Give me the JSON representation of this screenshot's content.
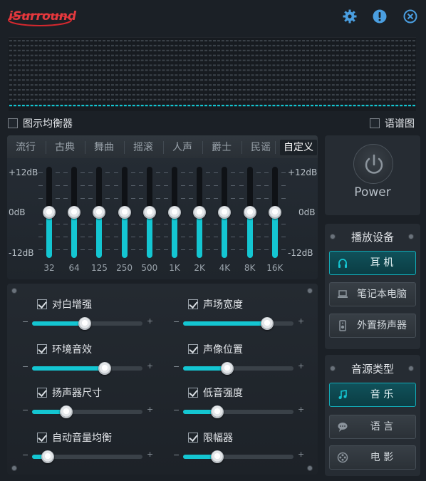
{
  "app": {
    "logo_text": "iSurround"
  },
  "header": {
    "icons": [
      "gear-icon",
      "info-icon",
      "close-icon"
    ]
  },
  "toggles": {
    "graphic_eq": {
      "label": "图示均衡器",
      "checked": false
    },
    "spectrum": {
      "label": "语谱图",
      "checked": false
    }
  },
  "eq": {
    "presets": [
      "流行",
      "古典",
      "舞曲",
      "摇滚",
      "人声",
      "爵士",
      "民谣",
      "自定义"
    ],
    "active_preset": "自定义",
    "db_top": "+12dB",
    "db_mid": "0dB",
    "db_bottom": "-12dB",
    "bands": [
      {
        "freq": "32",
        "gain_db": 0
      },
      {
        "freq": "64",
        "gain_db": 0
      },
      {
        "freq": "125",
        "gain_db": 0
      },
      {
        "freq": "250",
        "gain_db": 0
      },
      {
        "freq": "500",
        "gain_db": 0
      },
      {
        "freq": "1K",
        "gain_db": 0
      },
      {
        "freq": "2K",
        "gain_db": 0
      },
      {
        "freq": "4K",
        "gain_db": 0
      },
      {
        "freq": "8K",
        "gain_db": 0
      },
      {
        "freq": "16K",
        "gain_db": 0
      }
    ]
  },
  "effects": [
    {
      "label": "对白增强",
      "checked": true,
      "level": 0.48
    },
    {
      "label": "声场宽度",
      "checked": true,
      "level": 0.76
    },
    {
      "label": "环境音效",
      "checked": true,
      "level": 0.66
    },
    {
      "label": "声像位置",
      "checked": true,
      "level": 0.4
    },
    {
      "label": "扬声器尺寸",
      "checked": true,
      "level": 0.31
    },
    {
      "label": "低音强度",
      "checked": true,
      "level": 0.31
    },
    {
      "label": "自动音量均衡",
      "checked": true,
      "level": 0.14
    },
    {
      "label": "限幅器",
      "checked": true,
      "level": 0.31
    }
  ],
  "slider_minus": "−",
  "slider_plus": "+",
  "power": {
    "label": "Power"
  },
  "device": {
    "title": "播放设备",
    "options": [
      {
        "label": "耳 机",
        "icon": "headphones-icon",
        "active": true
      },
      {
        "label": "笔记本电脑",
        "icon": "laptop-icon",
        "active": false
      },
      {
        "label": "外置扬声器",
        "icon": "speaker-icon",
        "active": false
      }
    ]
  },
  "source": {
    "title": "音源类型",
    "options": [
      {
        "label": "音 乐",
        "icon": "music-note-icon",
        "active": true
      },
      {
        "label": "语 言",
        "icon": "speech-bubble-icon",
        "active": false
      },
      {
        "label": "电 影",
        "icon": "film-reel-icon",
        "active": false
      }
    ]
  },
  "colors": {
    "accent": "#14c6d2",
    "background": "#1b2026",
    "logo_red": "#d4282e"
  }
}
